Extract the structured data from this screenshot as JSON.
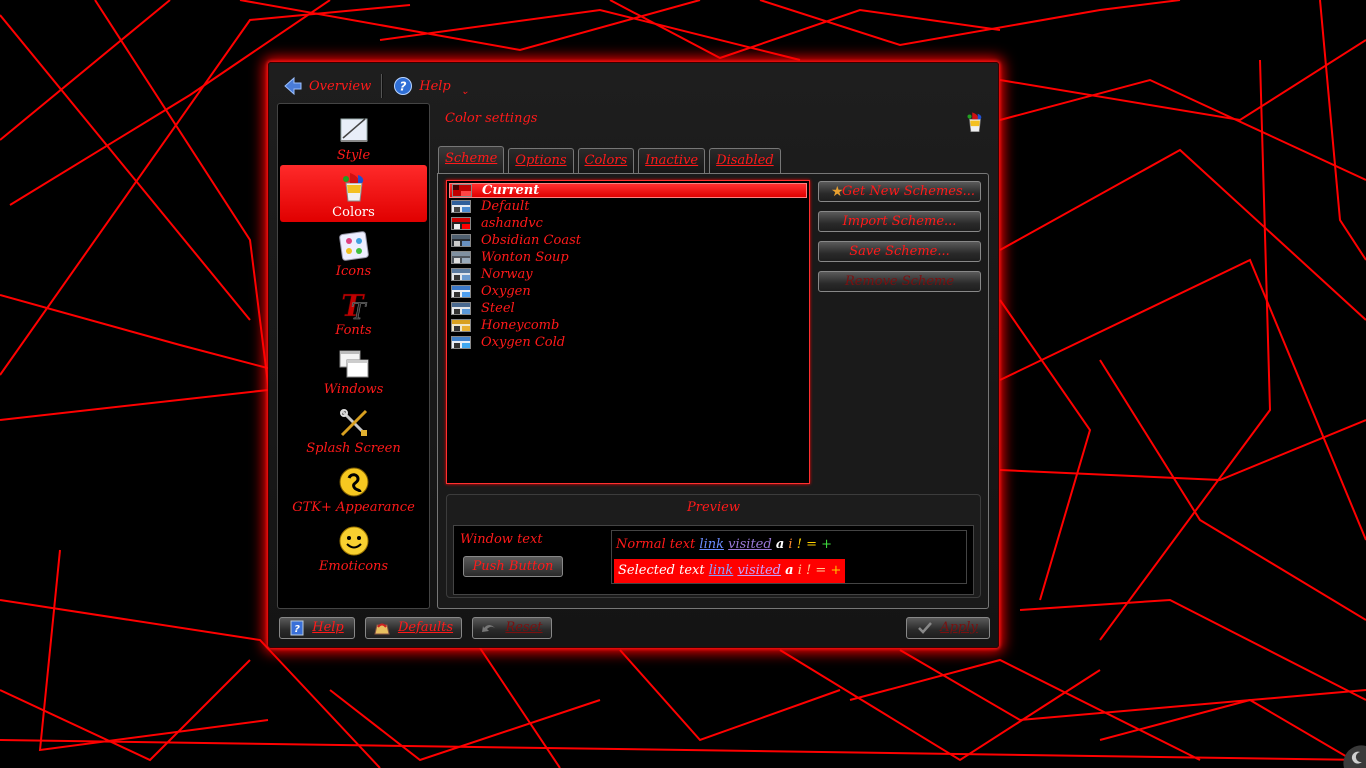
{
  "toolbar": {
    "overview_label": "Overview",
    "help_label": "Help"
  },
  "sidebar": {
    "items": [
      {
        "label": "Style",
        "icon": "style-icon"
      },
      {
        "label": "Colors",
        "icon": "colors-icon",
        "active": true
      },
      {
        "label": "Icons",
        "icon": "icons-icon"
      },
      {
        "label": "Fonts",
        "icon": "fonts-icon"
      },
      {
        "label": "Windows",
        "icon": "windows-icon"
      },
      {
        "label": "Splash Screen",
        "icon": "splash-screen-icon"
      },
      {
        "label": "GTK+ Appearance",
        "icon": "gtk-appearance-icon"
      },
      {
        "label": "Emoticons",
        "icon": "emoticons-icon"
      }
    ]
  },
  "content": {
    "title": "Color settings",
    "tabs": [
      {
        "label": "Scheme",
        "active": true
      },
      {
        "label": "Options"
      },
      {
        "label": "Colors"
      },
      {
        "label": "Inactive"
      },
      {
        "label": "Disabled"
      }
    ],
    "schemes": [
      {
        "name": "Current",
        "selected": true
      },
      {
        "name": "Default"
      },
      {
        "name": "ashandvc"
      },
      {
        "name": "Obsidian Coast"
      },
      {
        "name": "Wonton Soup"
      },
      {
        "name": "Norway"
      },
      {
        "name": "Oxygen"
      },
      {
        "name": "Steel"
      },
      {
        "name": "Honeycomb"
      },
      {
        "name": "Oxygen Cold"
      }
    ],
    "buttons": {
      "get_new": "Get New Schemes...",
      "import": "Import Scheme...",
      "save": "Save Scheme...",
      "remove": "Remove Scheme"
    },
    "preview": {
      "title": "Preview",
      "window_text": "Window text",
      "push_button": "Push Button",
      "normal_text": "Normal text",
      "selected_text": "Selected text",
      "link": "link",
      "visited": "visited",
      "a": "a",
      "i": "i",
      "excl": "!",
      "eq": "=",
      "plus": "+"
    }
  },
  "bottom": {
    "help": "Help",
    "defaults": "Defaults",
    "reset": "Reset",
    "apply": "Apply"
  },
  "colors": {
    "accent": "#ff0000",
    "text": "#ff1a1a",
    "window_bg": "#1a1a1a",
    "list_bg": "#000000"
  }
}
